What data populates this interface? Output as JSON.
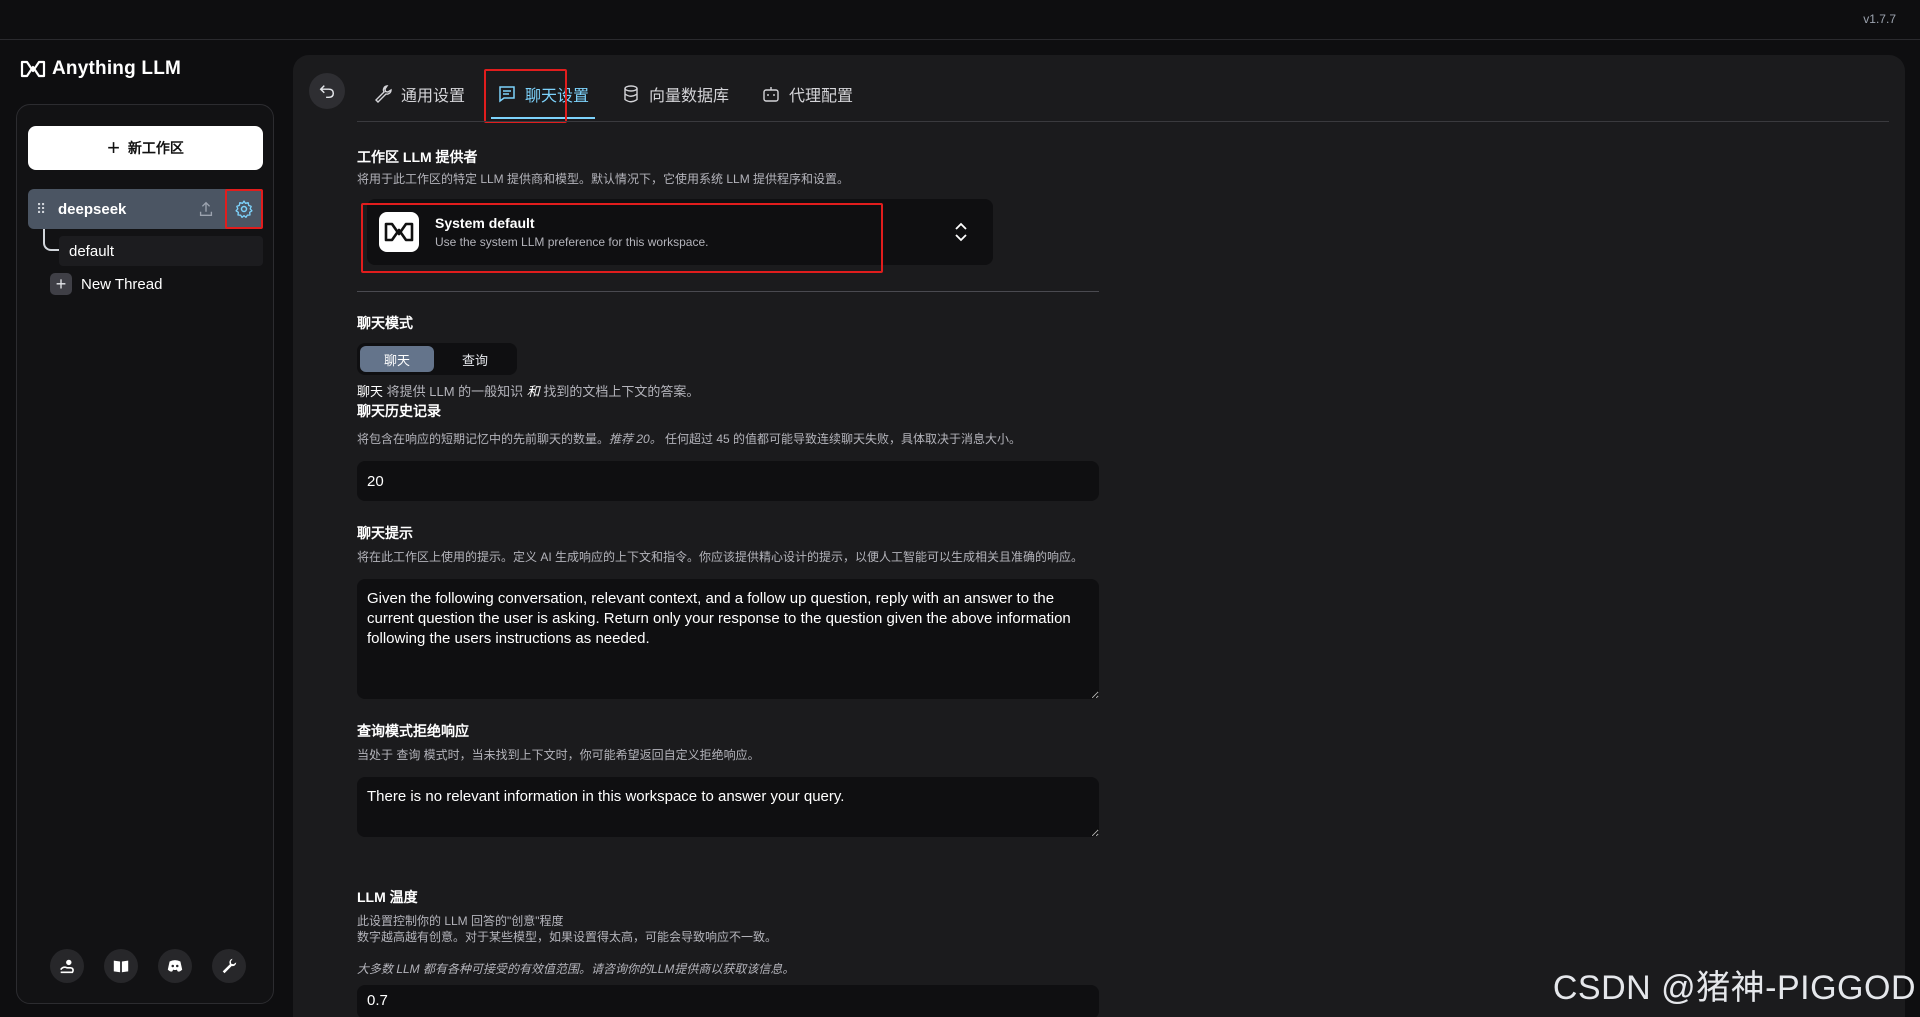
{
  "app": {
    "version": "v1.7.7",
    "logo_text": "Anything LLM"
  },
  "sidebar": {
    "new_workspace_label": "新工作区",
    "workspace": {
      "name": "deepseek"
    },
    "threads": [
      {
        "label": "default"
      }
    ],
    "new_thread_label": "New Thread",
    "footer_icons": [
      "community-hub-icon",
      "docs-book-icon",
      "discord-icon",
      "wrench-settings-icon"
    ]
  },
  "tabs": [
    {
      "label": "通用设置",
      "icon": "wrench-icon",
      "active": false
    },
    {
      "label": "聊天设置",
      "icon": "chat-icon",
      "active": true
    },
    {
      "label": "向量数据库",
      "icon": "database-icon",
      "active": false
    },
    {
      "label": "代理配置",
      "icon": "robot-icon",
      "active": false
    }
  ],
  "settings": {
    "llm_provider": {
      "label": "工作区 LLM 提供者",
      "description": "将用于此工作区的特定 LLM 提供商和模型。默认情况下，它使用系统 LLM 提供程序和设置。",
      "selected_title": "System default",
      "selected_subtitle": "Use the system LLM preference for this workspace."
    },
    "chat_mode": {
      "label": "聊天模式",
      "options": [
        "聊天",
        "查询"
      ],
      "selected": "聊天",
      "desc_prefix": "聊天",
      "desc_middle": " 将提供 LLM 的一般知识 ",
      "desc_emph": "和",
      "desc_suffix": " 找到的文档上下文的答案。"
    },
    "chat_history": {
      "label": "聊天历史记录",
      "desc_prefix": "将包含在响应的短期记忆中的先前聊天的数量。",
      "desc_emph": "推荐 20。",
      "desc_suffix": " 任何超过 45 的值都可能导致连续聊天失败，具体取决于消息大小。",
      "value": "20"
    },
    "chat_prompt": {
      "label": "聊天提示",
      "description": "将在此工作区上使用的提示。定义 AI 生成响应的上下文和指令。你应该提供精心设计的提示，以便人工智能可以生成相关且准确的响应。",
      "value": "Given the following conversation, relevant context, and a follow up question, reply with an answer to the current question the user is asking. Return only your response to the question given the above information following the users instructions as needed."
    },
    "query_refusal": {
      "label": "查询模式拒绝响应",
      "description": "当处于 查询 模式时，当未找到上下文时，你可能希望返回自定义拒绝响应。",
      "value": "There is no relevant information in this workspace to answer your query."
    },
    "llm_temperature": {
      "label": "LLM 温度",
      "desc_line1": "此设置控制你的 LLM 回答的\"创意\"程度",
      "desc_line2": "数字越高越有创意。对于某些模型，如果设置得太高，可能会导致响应不一致。",
      "desc_line3": "大多数 LLM 都有各种可接受的有效值范围。请咨询你的LLM提供商以获取该信息。",
      "value": "0.7"
    }
  },
  "watermark": "CSDN @猪神-PIGGOD",
  "colors": {
    "accent": "#7dd3fc",
    "highlight_box": "#e11d1d",
    "workspace_bg": "#4b5563"
  }
}
